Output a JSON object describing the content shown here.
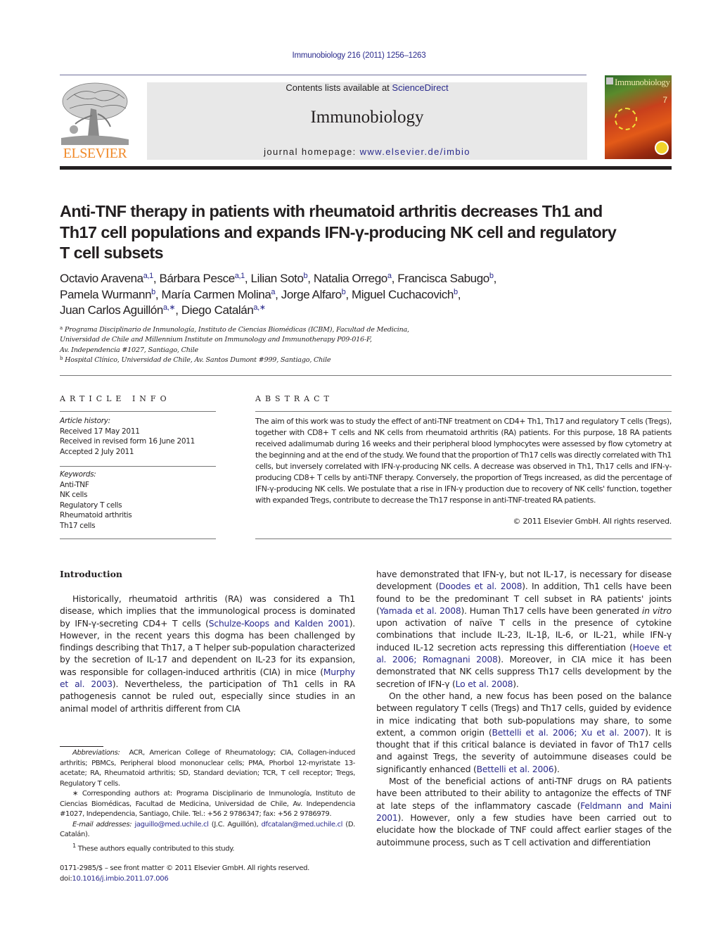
{
  "header": {
    "citation": "Immunobiology 216 (2011) 1256–1263",
    "contents_prefix": "Contents lists available at ",
    "contents_link": "ScienceDirect",
    "journal_name": "Immunobiology",
    "homepage_prefix": "journal homepage: ",
    "homepage_link": "www.elsevier.de/imbio",
    "publisher_logo_text": "ELSEVIER",
    "cover_title": "Immunobiology",
    "cover_issue": "7"
  },
  "colors": {
    "link": "#2a2a8c",
    "publisher_orange": "#f08a2a",
    "masthead_bg": "#e8e8e8"
  },
  "article": {
    "title": "Anti-TNF therapy in patients with rheumatoid arthritis decreases Th1 and Th17 cell populations and expands IFN-γ-producing NK cell and regulatory T cell subsets",
    "title_lines": [
      "Anti-TNF therapy in patients with rheumatoid arthritis decreases Th1 and",
      "Th17 cell populations and expands IFN-γ-producing NK cell and regulatory",
      "T cell subsets"
    ],
    "authors": [
      {
        "name": "Octavio Aravena",
        "marks": "a,1"
      },
      {
        "name": "Bárbara Pesce",
        "marks": "a,1"
      },
      {
        "name": "Lilian Soto",
        "marks": "b"
      },
      {
        "name": "Natalia Orrego",
        "marks": "a"
      },
      {
        "name": "Francisca Sabugo",
        "marks": "b"
      },
      {
        "name": "Pamela Wurmann",
        "marks": "b"
      },
      {
        "name": "María Carmen Molina",
        "marks": "a"
      },
      {
        "name": "Jorge Alfaro",
        "marks": "b"
      },
      {
        "name": "Miguel Cuchacovich",
        "marks": "b"
      },
      {
        "name": "Juan Carlos Aguillón",
        "marks": "a,∗"
      },
      {
        "name": "Diego Catalán",
        "marks": "a,∗"
      }
    ],
    "affiliations": [
      {
        "mark": "a",
        "lines": [
          "Programa Disciplinario de Inmunología, Instituto de Ciencias Biomédicas (ICBM), Facultad de Medicina,",
          "Universidad de Chile and Millennium Institute on Immunology and Immunotherapy P09-016-F,",
          "Av. Independencia #1027, Santiago, Chile"
        ]
      },
      {
        "mark": "b",
        "lines": [
          "Hospital Clínico, Universidad de Chile, Av. Santos Dumont #999, Santiago, Chile"
        ]
      }
    ]
  },
  "article_info": {
    "heading": "ARTICLE INFO",
    "history_label": "Article history:",
    "history": [
      "Received 17 May 2011",
      "Received in revised form 16 June 2011",
      "Accepted 2 July 2011"
    ],
    "keywords_label": "Keywords:",
    "keywords": [
      "Anti-TNF",
      "NK cells",
      "Regulatory T cells",
      "Rheumatoid arthritis",
      "Th17 cells"
    ]
  },
  "abstract": {
    "heading": "ABSTRACT",
    "text": "The aim of this work was to study the effect of anti-TNF treatment on CD4+ Th1, Th17 and regulatory T cells (Tregs), together with CD8+ T cells and NK cells from rheumatoid arthritis (RA) patients. For this purpose, 18 RA patients received adalimumab during 16 weeks and their peripheral blood lymphocytes were assessed by flow cytometry at the beginning and at the end of the study. We found that the proportion of Th17 cells was directly correlated with Th1 cells, but inversely correlated with IFN-γ-producing NK cells. A decrease was observed in Th1, Th17 cells and IFN-γ-producing CD8+ T cells by anti-TNF therapy. Conversely, the proportion of Tregs increased, as did the percentage of IFN-γ-producing NK cells. We postulate that a rise in IFN-γ production due to recovery of NK cells' function, together with expanded Tregs, contribute to decrease the Th17 response in anti-TNF-treated RA patients.",
    "copyright": "© 2011 Elsevier GmbH. All rights reserved."
  },
  "body": {
    "section_heading": "Introduction",
    "left_column": [
      {
        "type": "p",
        "segments": [
          {
            "t": "Historically, rheumatoid arthritis (RA) was considered a Th1 disease, which implies that the immunological process is dominated by IFN-γ-secreting CD4+ T cells ("
          },
          {
            "link": "Schulze-Koops and Kalden 2001"
          },
          {
            "t": "). However, in the recent years this dogma has been challenged by findings describing that Th17, a T helper sub-population characterized by the secretion of IL-17 and dependent on IL-23 for its expansion, was responsible for collagen-induced arthritis (CIA) in mice ("
          },
          {
            "link": "Murphy et al. 2003"
          },
          {
            "t": "). Nevertheless, the participation of Th1 cells in RA pathogenesis cannot be ruled out, especially since studies in an animal model of arthritis different from CIA"
          }
        ]
      }
    ],
    "right_column": [
      {
        "type": "p-cont",
        "segments": [
          {
            "t": "have demonstrated that IFN-γ, but not IL-17, is necessary for disease development ("
          },
          {
            "link": "Doodes et al. 2008"
          },
          {
            "t": "). In addition, Th1 cells have been found to be the predominant T cell subset in RA patients' joints ("
          },
          {
            "link": "Yamada et al. 2008"
          },
          {
            "t": "). Human Th17 cells have been generated "
          },
          {
            "i": "in vitro"
          },
          {
            "t": " upon activation of naïve T cells in the presence of cytokine combinations that include IL-23, IL-1β, IL-6, or IL-21, while IFN-γ induced IL-12 secretion acts repressing this differentiation ("
          },
          {
            "link": "Hoeve et al. 2006; Romagnani 2008"
          },
          {
            "t": "). Moreover, in CIA mice it has been demonstrated that NK cells suppress Th17 cells development by the secretion of IFN-γ ("
          },
          {
            "link": "Lo et al. 2008"
          },
          {
            "t": ")."
          }
        ]
      },
      {
        "type": "p",
        "segments": [
          {
            "t": "On the other hand, a new focus has been posed on the balance between regulatory T cells (Tregs) and Th17 cells, guided by evidence in mice indicating that both sub-populations may share, to some extent, a common origin ("
          },
          {
            "link": "Bettelli et al. 2006; Xu et al. 2007"
          },
          {
            "t": "). It is thought that if this critical balance is deviated in favor of Th17 cells and against Tregs, the severity of autoimmune diseases could be significantly enhanced ("
          },
          {
            "link": "Bettelli et al. 2006"
          },
          {
            "t": ")."
          }
        ]
      },
      {
        "type": "p",
        "segments": [
          {
            "t": "Most of the beneficial actions of anti-TNF drugs on RA patients have been attributed to their ability to antagonize the effects of TNF at late steps of the inflammatory cascade ("
          },
          {
            "link": "Feldmann and Maini 2001"
          },
          {
            "t": "). However, only a few studies have been carried out to elucidate how the blockade of TNF could affect earlier stages of the autoimmune process, such as T cell activation and differentiation"
          }
        ]
      }
    ]
  },
  "footnotes": {
    "abbreviations_label": "Abbreviations:",
    "abbreviations": "ACR, American College of Rheumatology; CIA, Collagen-induced arthritis; PBMCs, Peripheral blood mononuclear cells; PMA, Phorbol 12-myristate 13-acetate; RA, Rheumatoid arthritis; SD, Standard deviation; TCR, T cell receptor; Tregs, Regulatory T cells.",
    "corresponding": "∗ Corresponding authors at: Programa Disciplinario de Inmunología, Instituto de Ciencias Biomédicas, Facultad de Medicina, Universidad de Chile, Av. Independencia #1027, Independencia, Santiago, Chile. Tel.: +56 2 9786347; fax: +56 2 9786979.",
    "email_label": "E-mail addresses:",
    "email_1": "jaguillo@med.uchile.cl",
    "email_1_owner": " (J.C. Aguillón), ",
    "email_2": "dfcatalan@med.uchile.cl",
    "email_2_owner": " (D. Catalán).",
    "equal_contrib_mark": "1",
    "equal_contrib": " These authors equally contributed to this study."
  },
  "front_matter": {
    "issn_line": "0171-2985/$ – see front matter © 2011 Elsevier GmbH. All rights reserved.",
    "doi_prefix": "doi:",
    "doi": "10.1016/j.imbio.2011.07.006"
  }
}
